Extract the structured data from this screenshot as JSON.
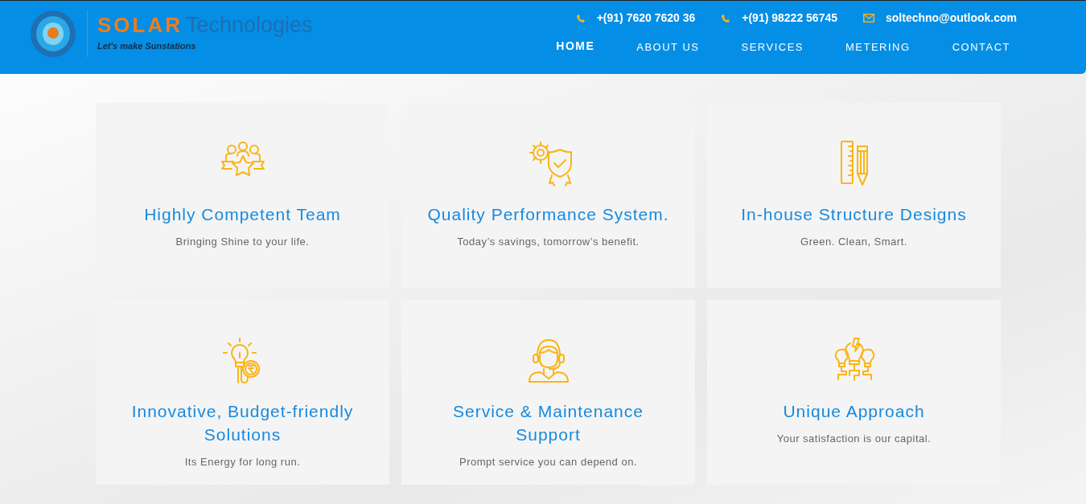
{
  "logo": {
    "brand": "SOLAR",
    "suffix": "Technologies",
    "tagline": "Let's make Sunstations"
  },
  "contacts": [
    {
      "kind": "phone",
      "text": "+(91) 7620 7620 36"
    },
    {
      "kind": "phone",
      "text": "+(91) 98222 56745"
    },
    {
      "kind": "email",
      "text": "soltechno@outlook.com"
    }
  ],
  "nav": [
    {
      "label": "HOME",
      "selected": true
    },
    {
      "label": "ABOUT US",
      "selected": false
    },
    {
      "label": "SERVICES",
      "selected": false
    },
    {
      "label": "METERING",
      "selected": false
    },
    {
      "label": "CONTACT",
      "selected": false
    }
  ],
  "features": [
    {
      "title": "Highly Competent Team",
      "text": "Bringing Shine to your life."
    },
    {
      "title": "Quality Performance System.",
      "text": "Today’s savings, tomorrow’s benefit."
    },
    {
      "title": "In-house Structure Designs",
      "text": "Green. Clean, Smart."
    },
    {
      "title": "Innovative, Budget-friendly Solutions",
      "text": "Its Energy for long run."
    },
    {
      "title": "Service & Maintenance Support",
      "text": "Prompt service you can depend on."
    },
    {
      "title": "Unique Approach",
      "text": "Your satisfaction is our capital."
    }
  ]
}
